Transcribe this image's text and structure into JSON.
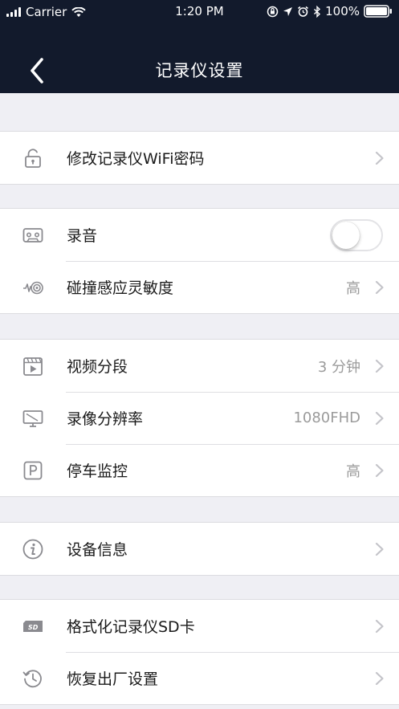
{
  "status_bar": {
    "carrier": "Carrier",
    "time": "1:20 PM",
    "battery": "100%"
  },
  "nav": {
    "title": "记录仪设置",
    "back_icon": "chevron-left-icon"
  },
  "groups": [
    {
      "rows": [
        {
          "icon": "lock-icon",
          "label": "修改记录仪WiFi密码",
          "value": "",
          "control": "chevron"
        }
      ]
    },
    {
      "rows": [
        {
          "icon": "cassette-icon",
          "label": "录音",
          "value": "",
          "control": "toggle",
          "toggle_on": false
        },
        {
          "icon": "collision-sensor-icon",
          "label": "碰撞感应灵敏度",
          "value": "高",
          "control": "chevron"
        }
      ]
    },
    {
      "rows": [
        {
          "icon": "video-clapper-icon",
          "label": "视频分段",
          "value": "3 分钟",
          "control": "chevron"
        },
        {
          "icon": "monitor-icon",
          "label": "录像分辨率",
          "value": "1080FHD",
          "control": "chevron"
        },
        {
          "icon": "parking-icon",
          "label": "停车监控",
          "value": "高",
          "control": "chevron"
        }
      ]
    },
    {
      "rows": [
        {
          "icon": "info-icon",
          "label": "设备信息",
          "value": "",
          "control": "chevron"
        }
      ]
    },
    {
      "rows": [
        {
          "icon": "sd-card-icon",
          "label": "格式化记录仪SD卡",
          "value": "",
          "control": "chevron"
        },
        {
          "icon": "history-icon",
          "label": "恢复出厂设置",
          "value": "",
          "control": "chevron"
        }
      ]
    }
  ],
  "colors": {
    "nav_background": "#121a2c",
    "page_background": "#efeff4",
    "secondary_text": "#9b9b9b"
  }
}
